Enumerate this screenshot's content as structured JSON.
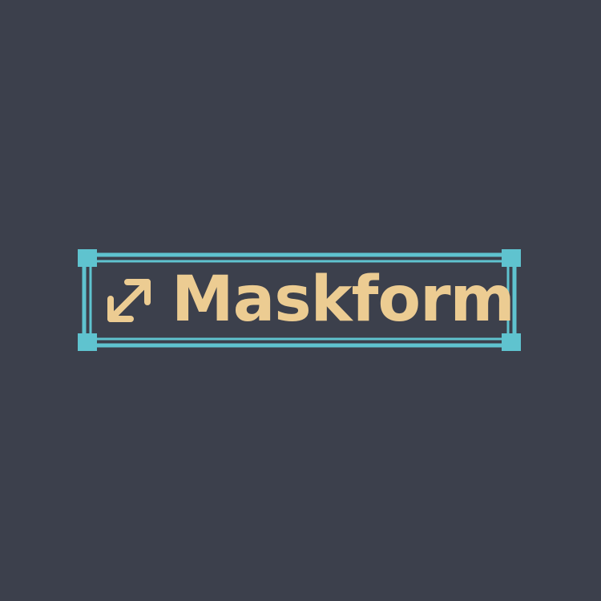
{
  "brand": {
    "name": "Maskform",
    "icon": "diagonal-resize-arrow-icon"
  },
  "colors": {
    "background": "#3c404c",
    "frame": "#5fc3cf",
    "text": "#eccc92"
  }
}
